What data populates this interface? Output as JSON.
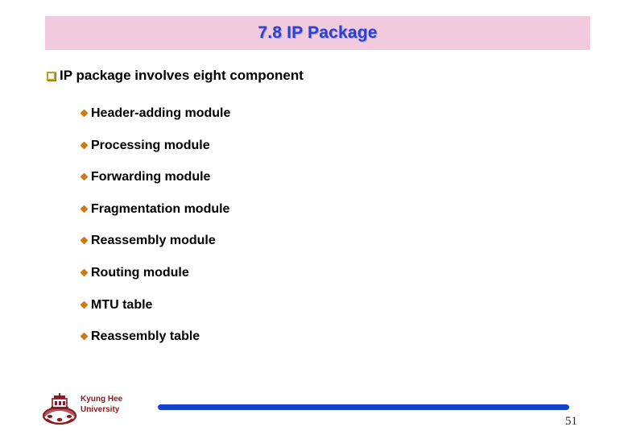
{
  "slide": {
    "title": "7.8 IP Package",
    "title_band_color": "#f2cadd",
    "title_text_color": "#2f3fd0",
    "background_color": "#ffffff"
  },
  "content": {
    "level1": {
      "bullet_icon": "hollow-square-bullet-icon",
      "bullet_color": "#c79a1e",
      "text": "IP package involves eight component"
    },
    "level2_bullet_icon": "diamond-bullet-icon",
    "level2_bullet_color": "#cc7a16",
    "level2_items": [
      {
        "text": "Header-adding module"
      },
      {
        "text": "Processing module"
      },
      {
        "text": "Forwarding module"
      },
      {
        "text": "Fragmentation module"
      },
      {
        "text": "Reassembly module"
      },
      {
        "text": "Routing module"
      },
      {
        "text": "MTU table"
      },
      {
        "text": "Reassembly table"
      }
    ]
  },
  "footer": {
    "logo_icon": "kyung-hee-university-crest-icon",
    "logo_color": "#8b1a22",
    "university_line1": "Kyung Hee",
    "university_line2": "University",
    "rule_color": "#1443cf",
    "page_number": "51"
  }
}
